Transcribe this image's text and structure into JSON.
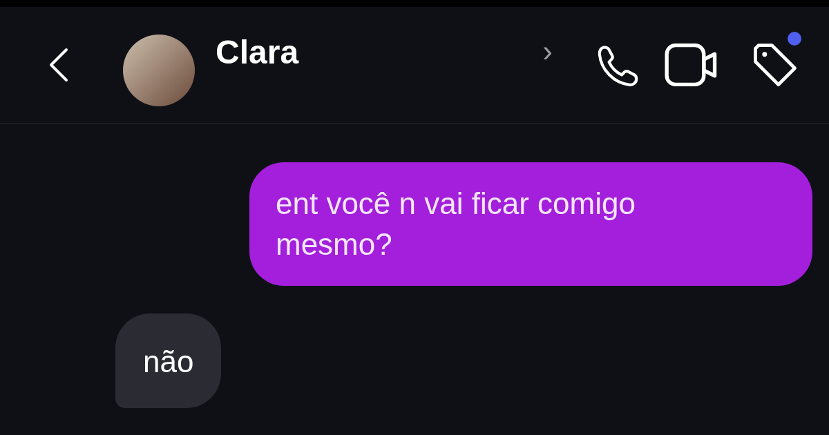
{
  "header": {
    "contact_name": "Clara",
    "chevron": "›",
    "tag_notification": true
  },
  "messages": [
    {
      "kind": "sent",
      "text": "ent você n vai ficar comigo mesmo?"
    },
    {
      "kind": "received",
      "text": "não"
    }
  ]
}
